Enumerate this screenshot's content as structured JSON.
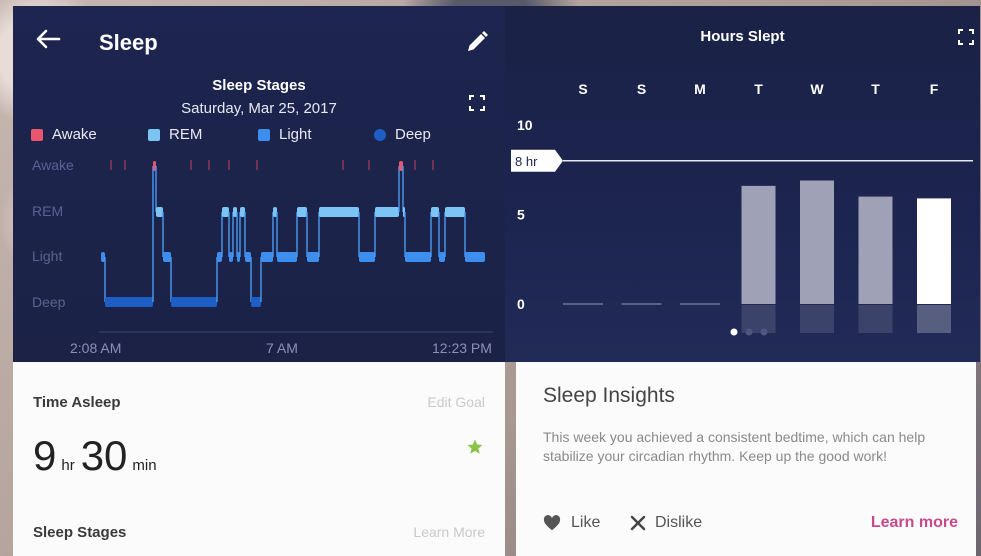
{
  "header": {
    "title": "Sleep"
  },
  "stages": {
    "title": "Sleep Stages",
    "date": "Saturday, Mar 25, 2017",
    "legend": [
      {
        "label": "Awake",
        "color": "#e8576d"
      },
      {
        "label": "REM",
        "color": "#7cc4f4"
      },
      {
        "label": "Light",
        "color": "#3e8ef0"
      },
      {
        "label": "Deep",
        "color": "#1f5fc5"
      }
    ],
    "ylabels": [
      "Awake",
      "REM",
      "Light",
      "Deep"
    ],
    "xlabels": [
      "2:08 AM",
      "7 AM",
      "12:23 PM"
    ]
  },
  "chart_data": {
    "type": "bar",
    "title": "Hours Slept",
    "categories": [
      "S",
      "S",
      "M",
      "T",
      "W",
      "T",
      "F"
    ],
    "values": [
      0,
      0,
      0,
      6.6,
      6.9,
      6.0,
      5.9
    ],
    "highlight_index": 6,
    "ylim": [
      0,
      10
    ],
    "yticks": [
      "10",
      "5",
      "0"
    ],
    "goal": {
      "label": "8 hr",
      "value": 8
    },
    "page_dots": 3,
    "active_dot": 0
  },
  "asleep": {
    "label": "Time Asleep",
    "edit_goal": "Edit Goal",
    "hours": "9",
    "hours_unit": "hr",
    "minutes": "30",
    "minutes_unit": "min",
    "stages_label": "Sleep Stages",
    "learn_more": "Learn More"
  },
  "insights": {
    "title": "Sleep Insights",
    "text": "This week you achieved a consistent bedtime, which can help stabilize your circadian rhythm. Keep up the good work!",
    "like": "Like",
    "dislike": "Dislike",
    "learn_more": "Learn more"
  },
  "colors": {
    "panel": "#1d2550",
    "accent_pink": "#c64a8c",
    "star": "#8bc34a"
  }
}
